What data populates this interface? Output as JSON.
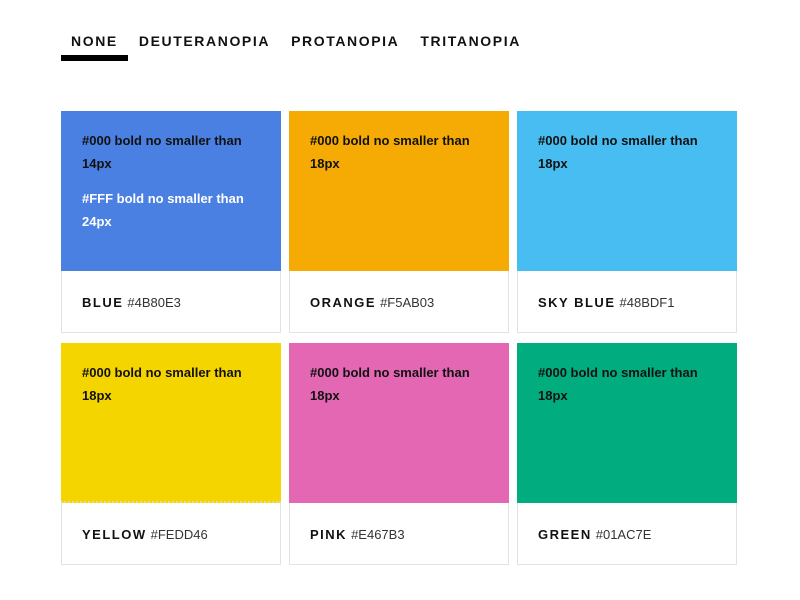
{
  "tabs": [
    {
      "label": "NONE",
      "active": true
    },
    {
      "label": "DEUTERANOPIA",
      "active": false
    },
    {
      "label": "PROTANOPIA",
      "active": false
    },
    {
      "label": "TRITANOPIA",
      "active": false
    }
  ],
  "swatches": [
    {
      "name": "BLUE",
      "hex": "#4B80E3",
      "color": "#4B80E3",
      "note_dark": "#000 bold no smaller than 14px",
      "note_light": "#FFF bold no smaller than 24px"
    },
    {
      "name": "ORANGE",
      "hex": "#F5AB03",
      "color": "#F5AB03",
      "note_dark": "#000 bold no smaller than 18px"
    },
    {
      "name": "SKY BLUE",
      "hex": "#48BDF1",
      "color": "#48BDF1",
      "note_dark": "#000 bold no smaller than 18px"
    },
    {
      "name": "YELLOW",
      "hex": "#FEDD46",
      "color": "#F5D500",
      "note_dark": "#000 bold no smaller than 18px"
    },
    {
      "name": "PINK",
      "hex": "#E467B3",
      "color": "#E467B3",
      "note_dark": "#000 bold no smaller than 18px"
    },
    {
      "name": "GREEN",
      "hex": "#01AC7E",
      "color": "#01AC7E",
      "note_dark": "#000 bold no smaller than 18px"
    }
  ]
}
